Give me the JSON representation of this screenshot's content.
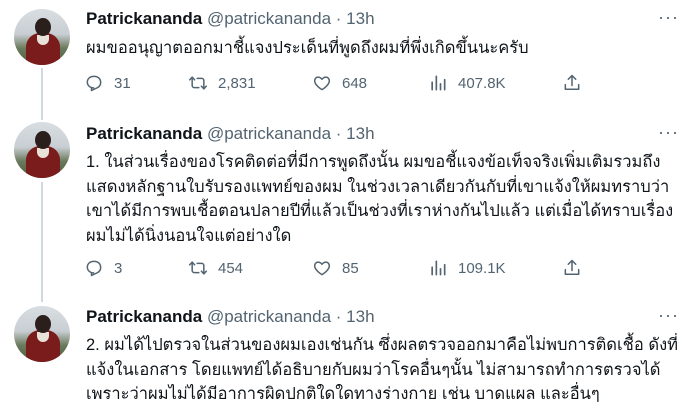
{
  "tweets": [
    {
      "name": "Patrickananda",
      "handle": "@patrickananda",
      "sep": "·",
      "time": "13h",
      "more": "···",
      "text": "ผมขออนุญาตออกมาชี้แจงประเด็นที่พูดถึงผมที่พึ่งเกิดขึ้นนะครับ",
      "replies": "31",
      "retweets": "2,831",
      "likes": "648",
      "views": "407.8K"
    },
    {
      "name": "Patrickananda",
      "handle": "@patrickananda",
      "sep": "·",
      "time": "13h",
      "more": "···",
      "text": "1. ในส่วนเรื่องของโรคติดต่อที่มีการพูดถึงนั้น ผมขอชี้แจงข้อเท็จจริงเพิ่มเติมรวมถึงแสดงหลักฐานใบรับรองแพทย์ของผม ในช่วงเวลาเดียวกันกับที่เขาแจ้งให้ผมทราบว่าเขาได้มีการพบเชื้อตอนปลายปีที่แล้วเป็นช่วงที่เราห่างกันไปแล้ว แต่เมื่อได้ทราบเรื่องผมไม่ได้นิ่งนอนใจแต่อย่างใด",
      "replies": "3",
      "retweets": "454",
      "likes": "85",
      "views": "109.1K"
    },
    {
      "name": "Patrickananda",
      "handle": "@patrickananda",
      "sep": "·",
      "time": "13h",
      "more": "···",
      "text": "2. ผมได้ไปตรวจในส่วนของผมเองเช่นกัน ซึ่งผลตรวจออกมาคือไม่พบการติดเชื้อ ดังที่แจ้งในเอกสาร โดยแพทย์ได้อธิบายกับผมว่าโรคอื่นๆนั้น ไม่สามารถทำการตรวจได้เพราะว่าผมไม่ได้มีอาการผิดปกติใดใดทางร่างกาย เช่น บาดแผล และอื่นๆ"
    }
  ],
  "icons": {
    "reply": "reply-icon",
    "retweet": "retweet-icon",
    "like": "like-icon",
    "views": "views-icon",
    "share": "share-icon",
    "more": "more-icon"
  }
}
